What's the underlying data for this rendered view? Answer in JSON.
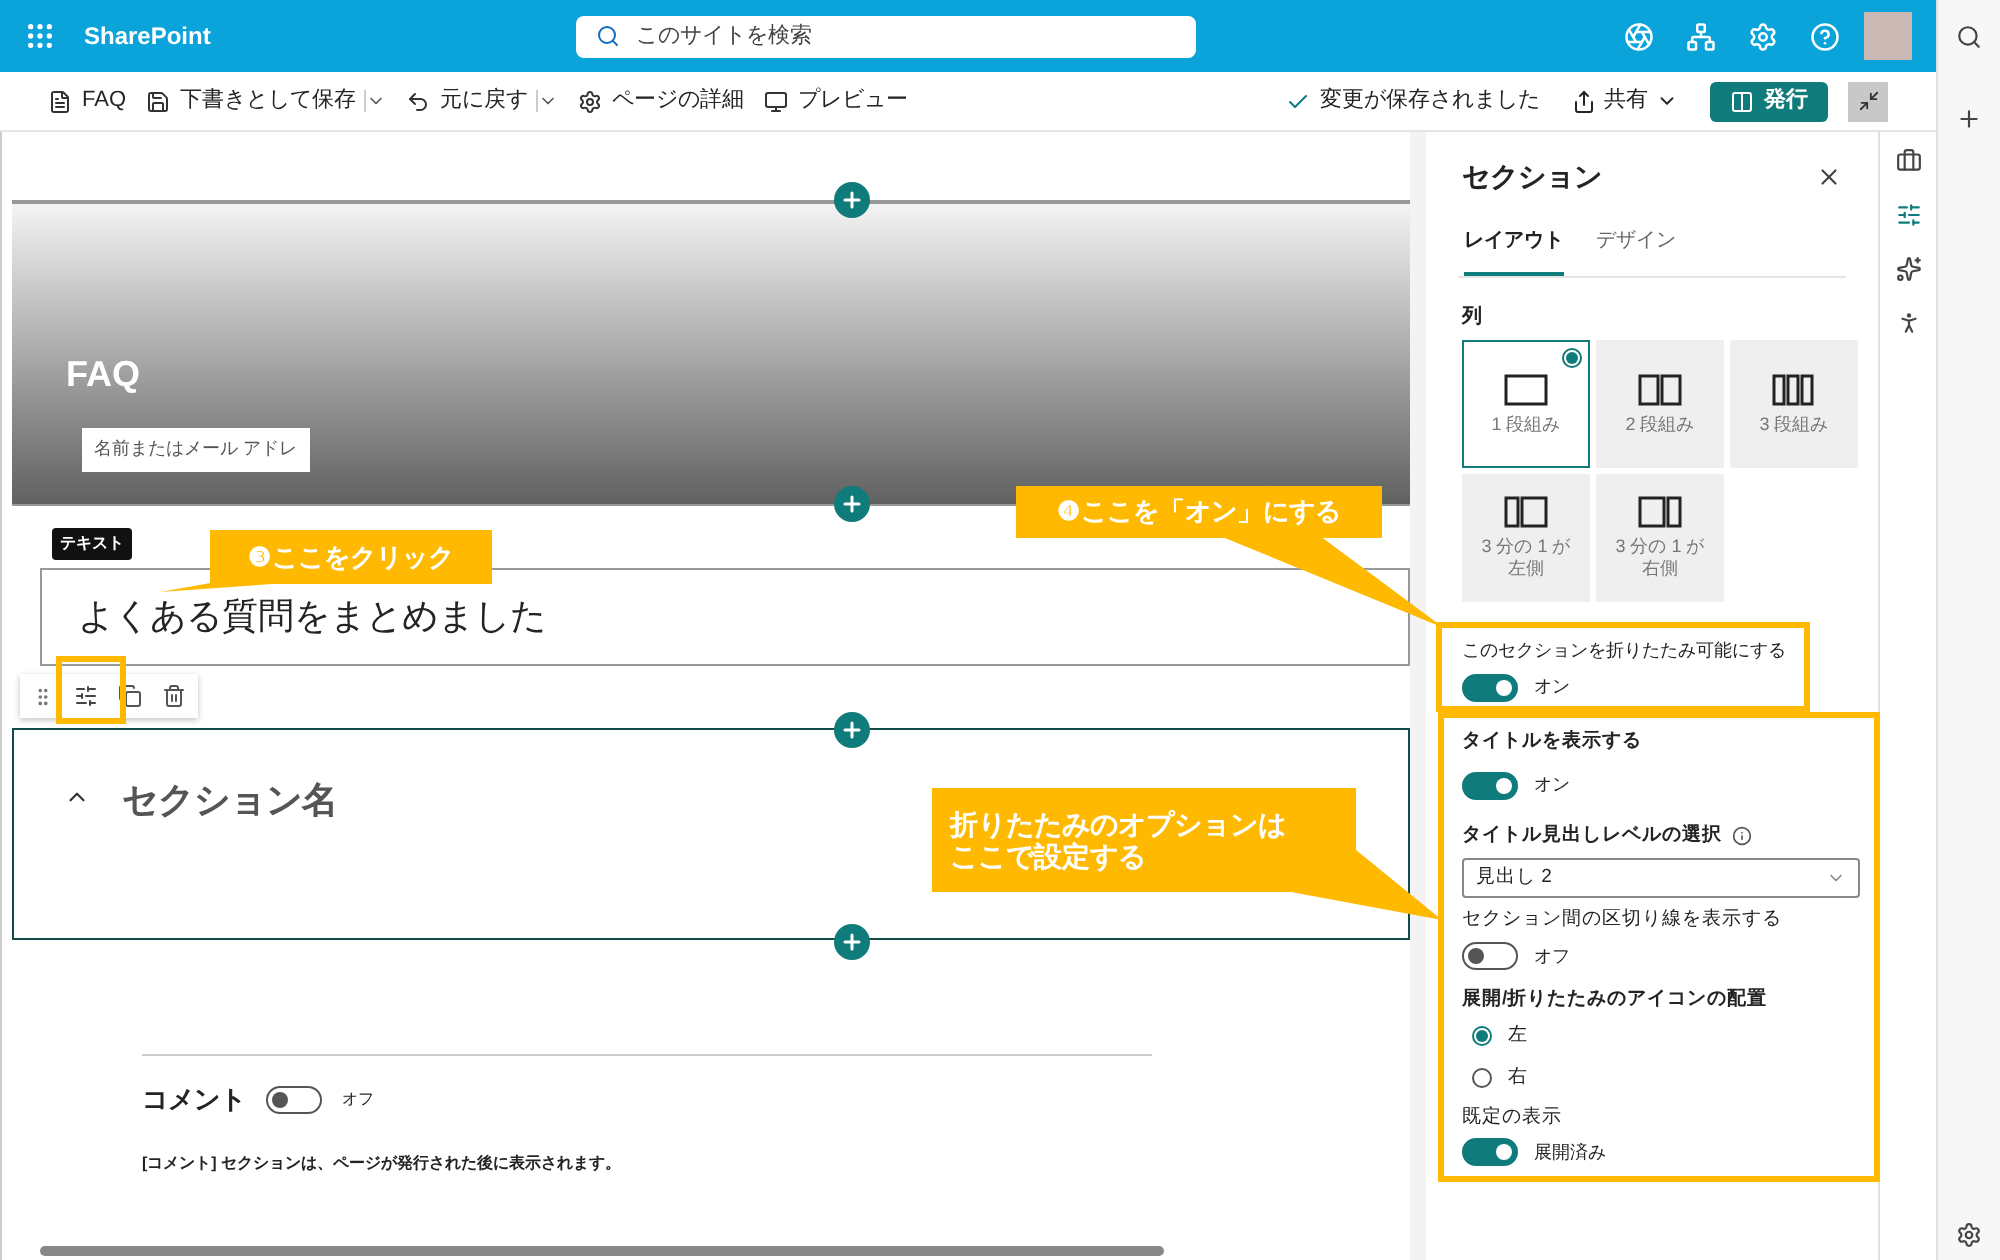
{
  "app": {
    "name": "SharePoint",
    "search_placeholder": "このサイトを検索"
  },
  "toolbar": {
    "items": [
      {
        "kind": "page",
        "label": "FAQ",
        "dropdown": false
      },
      {
        "kind": "save",
        "label": "下書きとして保存",
        "dropdown": true
      },
      {
        "kind": "undo",
        "label": "元に戻す",
        "dropdown": true
      },
      {
        "kind": "details",
        "label": "ページの詳細",
        "dropdown": false
      },
      {
        "kind": "preview",
        "label": "プレビュー",
        "dropdown": false
      }
    ],
    "status": "変更が保存されました",
    "share": "共有",
    "publish": "発行"
  },
  "canvas": {
    "hero_title": "FAQ",
    "author_placeholder": "名前またはメール アドレ",
    "text_tag": "テキスト",
    "text_content": "よくある質問をまとめました",
    "section": {
      "title": "セクション名",
      "expanded": true
    },
    "comments": {
      "label": "コメント",
      "on": false,
      "state": "オフ",
      "note": "[コメント] セクションは、ページが発行された後に表示されます。"
    }
  },
  "panel": {
    "title": "セクション",
    "tabs": [
      {
        "label": "レイアウト",
        "selected": true
      },
      {
        "label": "デザイン",
        "selected": false
      }
    ],
    "columns_label": "列",
    "layouts": [
      {
        "kind": "one",
        "label_lines": [
          "1 段組み"
        ],
        "selected": true
      },
      {
        "kind": "two",
        "label_lines": [
          "2 段組み"
        ],
        "selected": false
      },
      {
        "kind": "three",
        "label_lines": [
          "3 段組み"
        ],
        "selected": false
      },
      {
        "kind": "left",
        "label_lines": [
          "3 分の 1 が",
          "左側"
        ],
        "selected": false
      },
      {
        "kind": "right",
        "label_lines": [
          "3 分の 1 が",
          "右側"
        ],
        "selected": false
      }
    ],
    "collapsible": {
      "label": "このセクションを折りたたみ可能にする",
      "on": true,
      "state": "オン"
    },
    "show_title": {
      "label": "タイトルを表示する",
      "on": true,
      "state": "オン"
    },
    "heading_level": {
      "label": "タイトル見出しレベルの選択",
      "value": "見出し 2"
    },
    "divider": {
      "label": "セクション間の区切り線を表示する",
      "on": false,
      "state": "オフ"
    },
    "icon_position": {
      "label": "展開/折りたたみのアイコンの配置",
      "options": [
        {
          "label": "左",
          "selected": true
        },
        {
          "label": "右",
          "selected": false
        }
      ]
    },
    "default_view": {
      "label": "既定の表示",
      "on": true,
      "state": "展開済み"
    }
  },
  "callouts": [
    {
      "text": "❸ここをクリック"
    },
    {
      "text": "❹ここを「オン」にする"
    },
    {
      "lines": [
        "折りたたみのオプションは",
        "ここで設定する"
      ]
    }
  ]
}
